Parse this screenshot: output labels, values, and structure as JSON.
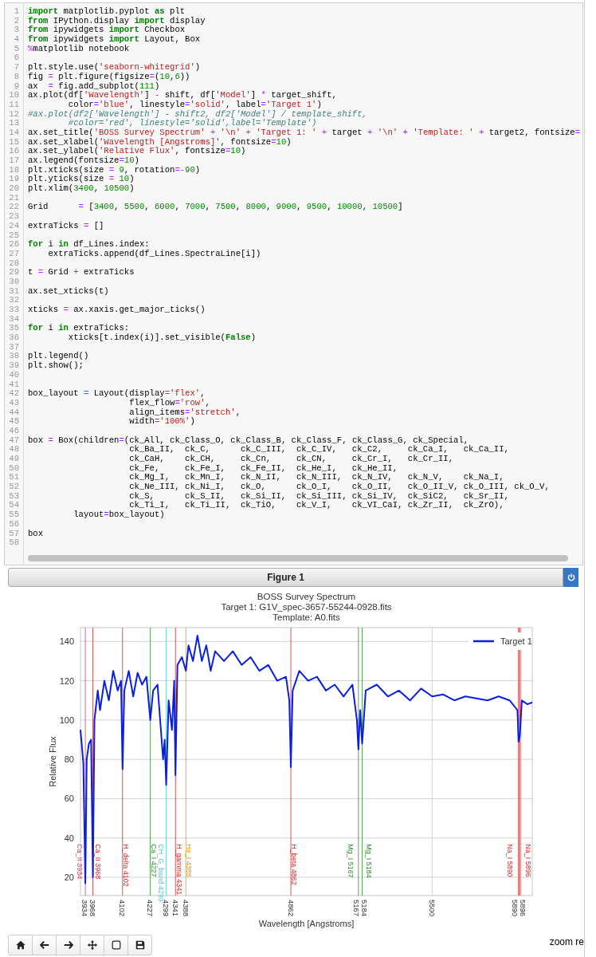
{
  "code_cell": {
    "lines": [
      {
        "number": "1",
        "tokens": [
          {
            "text": "import",
            "kind": "keyword"
          },
          {
            "text": " matplotlib.pyplot ",
            "kind": "plain"
          },
          {
            "text": "as",
            "kind": "keyword"
          },
          {
            "text": " plt",
            "kind": "plain"
          }
        ]
      },
      {
        "number": "2",
        "tokens": [
          {
            "text": "from",
            "kind": "keyword"
          },
          {
            "text": " IPython.display ",
            "kind": "plain"
          },
          {
            "text": "import",
            "kind": "keyword"
          },
          {
            "text": " display",
            "kind": "plain"
          }
        ]
      },
      {
        "number": "3",
        "tokens": [
          {
            "text": "from",
            "kind": "keyword"
          },
          {
            "text": " ipywidgets ",
            "kind": "plain"
          },
          {
            "text": "import",
            "kind": "keyword"
          },
          {
            "text": " Checkbox",
            "kind": "plain"
          }
        ]
      },
      {
        "number": "4",
        "tokens": [
          {
            "text": "from",
            "kind": "keyword"
          },
          {
            "text": " ipywidgets ",
            "kind": "plain"
          },
          {
            "text": "import",
            "kind": "keyword"
          },
          {
            "text": " Layout, Box",
            "kind": "plain"
          }
        ]
      },
      {
        "number": "5",
        "tokens": [
          {
            "text": "%",
            "kind": "operator"
          },
          {
            "text": "matplotlib notebook",
            "kind": "plain"
          }
        ]
      },
      {
        "number": "6"
      },
      {
        "number": "7",
        "tokens": [
          {
            "text": "plt.style.use(",
            "kind": "plain"
          },
          {
            "text": "'seaborn-whitegrid'",
            "kind": "string"
          },
          {
            "text": ")",
            "kind": "plain"
          }
        ]
      },
      {
        "number": "8",
        "tokens": [
          {
            "text": "fig ",
            "kind": "plain"
          },
          {
            "text": "=",
            "kind": "operator"
          },
          {
            "text": " plt.figure(figsize",
            "kind": "plain"
          },
          {
            "text": "=",
            "kind": "operator"
          },
          {
            "text": "(",
            "kind": "plain"
          },
          {
            "text": "10",
            "kind": "number"
          },
          {
            "text": ",",
            "kind": "plain"
          },
          {
            "text": "6",
            "kind": "number"
          },
          {
            "text": "))",
            "kind": "plain"
          }
        ]
      },
      {
        "number": "9",
        "tokens": [
          {
            "text": "ax  ",
            "kind": "plain"
          },
          {
            "text": "=",
            "kind": "operator"
          },
          {
            "text": " fig.add_subplot(",
            "kind": "plain"
          },
          {
            "text": "111",
            "kind": "number"
          },
          {
            "text": ")",
            "kind": "plain"
          }
        ]
      },
      {
        "number": "10",
        "tokens": [
          {
            "text": "ax.plot(df[",
            "kind": "plain"
          },
          {
            "text": "'Wavelength'",
            "kind": "string"
          },
          {
            "text": "] ",
            "kind": "plain"
          },
          {
            "text": "-",
            "kind": "operator"
          },
          {
            "text": " shift, df[",
            "kind": "plain"
          },
          {
            "text": "'Model'",
            "kind": "string"
          },
          {
            "text": "] ",
            "kind": "plain"
          },
          {
            "text": "*",
            "kind": "operator"
          },
          {
            "text": " target_shift,",
            "kind": "plain"
          }
        ]
      },
      {
        "number": "11",
        "tokens": [
          {
            "text": "        color",
            "kind": "plain"
          },
          {
            "text": "=",
            "kind": "operator"
          },
          {
            "text": "'blue'",
            "kind": "string"
          },
          {
            "text": ", linestyle",
            "kind": "plain"
          },
          {
            "text": "=",
            "kind": "operator"
          },
          {
            "text": "'solid'",
            "kind": "string"
          },
          {
            "text": ", label",
            "kind": "plain"
          },
          {
            "text": "=",
            "kind": "operator"
          },
          {
            "text": "'Target 1'",
            "kind": "string"
          },
          {
            "text": ")",
            "kind": "plain"
          }
        ]
      },
      {
        "number": "12",
        "tokens": [
          {
            "text": "#ax.plot(df2['Wavelength'] - shift2, df2['Model'] / template_shift,",
            "kind": "comment"
          }
        ]
      },
      {
        "number": "13",
        "tokens": [
          {
            "text": "        #color='red', linestyle='solid',label='Template')",
            "kind": "comment"
          }
        ]
      },
      {
        "number": "14",
        "tokens": [
          {
            "text": "ax.set_title(",
            "kind": "plain"
          },
          {
            "text": "'BOSS Survey Spectrum'",
            "kind": "string"
          },
          {
            "text": " + ",
            "kind": "operator"
          },
          {
            "text": "'\\n'",
            "kind": "string"
          },
          {
            "text": " + ",
            "kind": "operator"
          },
          {
            "text": "'Target 1: '",
            "kind": "string"
          },
          {
            "text": " + ",
            "kind": "operator"
          },
          {
            "text": "target",
            "kind": "plain"
          },
          {
            "text": " + ",
            "kind": "operator"
          },
          {
            "text": "'\\n'",
            "kind": "string"
          },
          {
            "text": " + ",
            "kind": "operator"
          },
          {
            "text": "'Template: '",
            "kind": "string"
          },
          {
            "text": " + ",
            "kind": "operator"
          },
          {
            "text": "target2, fontsize",
            "kind": "plain"
          },
          {
            "text": "=",
            "kind": "operator"
          }
        ]
      },
      {
        "number": "15",
        "tokens": [
          {
            "text": "ax.set_xlabel(",
            "kind": "plain"
          },
          {
            "text": "'Wavelength [Angstroms]'",
            "kind": "string"
          },
          {
            "text": ", fontsize",
            "kind": "plain"
          },
          {
            "text": "=",
            "kind": "operator"
          },
          {
            "text": "10",
            "kind": "number"
          },
          {
            "text": ")",
            "kind": "plain"
          }
        ]
      },
      {
        "number": "16",
        "tokens": [
          {
            "text": "ax.set_ylabel(",
            "kind": "plain"
          },
          {
            "text": "'Relative Flux'",
            "kind": "string"
          },
          {
            "text": ", fontsize",
            "kind": "plain"
          },
          {
            "text": "=",
            "kind": "operator"
          },
          {
            "text": "10",
            "kind": "number"
          },
          {
            "text": ")",
            "kind": "plain"
          }
        ]
      },
      {
        "number": "17",
        "tokens": [
          {
            "text": "ax.legend(fontsize",
            "kind": "plain"
          },
          {
            "text": "=",
            "kind": "operator"
          },
          {
            "text": "10",
            "kind": "number"
          },
          {
            "text": ")",
            "kind": "plain"
          }
        ]
      },
      {
        "number": "18",
        "tokens": [
          {
            "text": "plt.xticks(size ",
            "kind": "plain"
          },
          {
            "text": "= ",
            "kind": "operator"
          },
          {
            "text": "9",
            "kind": "number"
          },
          {
            "text": ", rotation",
            "kind": "plain"
          },
          {
            "text": "=-",
            "kind": "operator"
          },
          {
            "text": "90",
            "kind": "number"
          },
          {
            "text": ")",
            "kind": "plain"
          }
        ]
      },
      {
        "number": "19",
        "tokens": [
          {
            "text": "plt.yticks(size ",
            "kind": "plain"
          },
          {
            "text": "= ",
            "kind": "operator"
          },
          {
            "text": "10",
            "kind": "number"
          },
          {
            "text": ")",
            "kind": "plain"
          }
        ]
      },
      {
        "number": "20",
        "tokens": [
          {
            "text": "plt.xlim(",
            "kind": "plain"
          },
          {
            "text": "3400",
            "kind": "number"
          },
          {
            "text": ", ",
            "kind": "plain"
          },
          {
            "text": "10500",
            "kind": "number"
          },
          {
            "text": ")",
            "kind": "plain"
          }
        ]
      },
      {
        "number": "21"
      },
      {
        "number": "22",
        "tokens": [
          {
            "text": "Grid      ",
            "kind": "plain"
          },
          {
            "text": "=",
            "kind": "operator"
          },
          {
            "text": " [",
            "kind": "plain"
          },
          {
            "text": "3400",
            "kind": "number"
          },
          {
            "text": ", ",
            "kind": "plain"
          },
          {
            "text": "5500",
            "kind": "number"
          },
          {
            "text": ", ",
            "kind": "plain"
          },
          {
            "text": "6000",
            "kind": "number"
          },
          {
            "text": ", ",
            "kind": "plain"
          },
          {
            "text": "7000",
            "kind": "number"
          },
          {
            "text": ", ",
            "kind": "plain"
          },
          {
            "text": "7500",
            "kind": "number"
          },
          {
            "text": ", ",
            "kind": "plain"
          },
          {
            "text": "8000",
            "kind": "number"
          },
          {
            "text": ", ",
            "kind": "plain"
          },
          {
            "text": "9000",
            "kind": "number"
          },
          {
            "text": ", ",
            "kind": "plain"
          },
          {
            "text": "9500",
            "kind": "number"
          },
          {
            "text": ", ",
            "kind": "plain"
          },
          {
            "text": "10000",
            "kind": "number"
          },
          {
            "text": ", ",
            "kind": "plain"
          },
          {
            "text": "10500",
            "kind": "number"
          },
          {
            "text": "]",
            "kind": "plain"
          }
        ]
      },
      {
        "number": "23"
      },
      {
        "number": "24",
        "tokens": [
          {
            "text": "extraTicks ",
            "kind": "plain"
          },
          {
            "text": "=",
            "kind": "operator"
          },
          {
            "text": " []",
            "kind": "plain"
          }
        ]
      },
      {
        "number": "25"
      },
      {
        "number": "26",
        "tokens": [
          {
            "text": "for",
            "kind": "keyword"
          },
          {
            "text": " i ",
            "kind": "plain"
          },
          {
            "text": "in",
            "kind": "keyword"
          },
          {
            "text": " df_Lines.index:",
            "kind": "plain"
          }
        ]
      },
      {
        "number": "27",
        "tokens": [
          {
            "text": "    extraTicks.append(df_Lines.SpectraLine[i])",
            "kind": "plain"
          }
        ]
      },
      {
        "number": "28"
      },
      {
        "number": "29",
        "tokens": [
          {
            "text": "t ",
            "kind": "plain"
          },
          {
            "text": "=",
            "kind": "operator"
          },
          {
            "text": " Grid ",
            "kind": "plain"
          },
          {
            "text": "+",
            "kind": "operator"
          },
          {
            "text": " extraTicks",
            "kind": "plain"
          }
        ]
      },
      {
        "number": "30"
      },
      {
        "number": "31",
        "tokens": [
          {
            "text": "ax.set_xticks(t)",
            "kind": "plain"
          }
        ]
      },
      {
        "number": "32"
      },
      {
        "number": "33",
        "tokens": [
          {
            "text": "xticks ",
            "kind": "plain"
          },
          {
            "text": "=",
            "kind": "operator"
          },
          {
            "text": " ax.xaxis.get_major_ticks()",
            "kind": "plain"
          }
        ]
      },
      {
        "number": "34"
      },
      {
        "number": "35",
        "tokens": [
          {
            "text": "for",
            "kind": "keyword"
          },
          {
            "text": " i ",
            "kind": "plain"
          },
          {
            "text": "in",
            "kind": "keyword"
          },
          {
            "text": " extraTicks:",
            "kind": "plain"
          }
        ]
      },
      {
        "number": "36",
        "tokens": [
          {
            "text": "        xticks[t.index(i)].set_visible(",
            "kind": "plain"
          },
          {
            "text": "False",
            "kind": "keyword"
          },
          {
            "text": ")",
            "kind": "plain"
          }
        ]
      },
      {
        "number": "37"
      },
      {
        "number": "38",
        "tokens": [
          {
            "text": "plt.legend()",
            "kind": "plain"
          }
        ]
      },
      {
        "number": "39",
        "tokens": [
          {
            "text": "plt.show();",
            "kind": "plain"
          }
        ]
      },
      {
        "number": "40"
      },
      {
        "number": "41"
      },
      {
        "number": "42",
        "tokens": [
          {
            "text": "box_layout ",
            "kind": "plain"
          },
          {
            "text": "=",
            "kind": "operator"
          },
          {
            "text": " Layout(display",
            "kind": "plain"
          },
          {
            "text": "=",
            "kind": "operator"
          },
          {
            "text": "'flex'",
            "kind": "string"
          },
          {
            "text": ",",
            "kind": "plain"
          }
        ]
      },
      {
        "number": "43",
        "tokens": [
          {
            "text": "                    flex_flow",
            "kind": "plain"
          },
          {
            "text": "=",
            "kind": "operator"
          },
          {
            "text": "'row'",
            "kind": "string"
          },
          {
            "text": ",",
            "kind": "plain"
          }
        ]
      },
      {
        "number": "44",
        "tokens": [
          {
            "text": "                    align_items",
            "kind": "plain"
          },
          {
            "text": "=",
            "kind": "operator"
          },
          {
            "text": "'stretch'",
            "kind": "string"
          },
          {
            "text": ",",
            "kind": "plain"
          }
        ]
      },
      {
        "number": "45",
        "tokens": [
          {
            "text": "                    width",
            "kind": "plain"
          },
          {
            "text": "=",
            "kind": "operator"
          },
          {
            "text": "'100%'",
            "kind": "string"
          },
          {
            "text": ")",
            "kind": "plain"
          }
        ]
      },
      {
        "number": "46"
      },
      {
        "number": "47",
        "tokens": [
          {
            "text": "box ",
            "kind": "plain"
          },
          {
            "text": "=",
            "kind": "operator"
          },
          {
            "text": " Box(children",
            "kind": "plain"
          },
          {
            "text": "=",
            "kind": "operator"
          },
          {
            "text": "(ck_All, ck_Class_O, ck_Class_B, ck_Class_F, ck_Class_G, ck_Special,",
            "kind": "plain"
          }
        ]
      },
      {
        "number": "48",
        "tokens": [
          {
            "text": "                    ck_Ba_II,  ck_C,      ck_C_III,  ck_C_IV,   ck_C2,     ck_Ca_I,   ck_Ca_II,",
            "kind": "plain"
          }
        ]
      },
      {
        "number": "49",
        "tokens": [
          {
            "text": "                    ck_CaH,    ck_CH,     ck_Cn,     ck_CN,     ck_Cr_I,   ck_Cr_II,",
            "kind": "plain"
          }
        ]
      },
      {
        "number": "50",
        "tokens": [
          {
            "text": "                    ck_Fe,     ck_Fe_I,   ck_Fe_II,  ck_He_I,   ck_He_II,",
            "kind": "plain"
          }
        ]
      },
      {
        "number": "51",
        "tokens": [
          {
            "text": "                    ck_Mg_I,   ck_Mn_I,   ck_N_II,   ck_N_III,  ck_N_IV,   ck_N_V,    ck_Na_I,",
            "kind": "plain"
          }
        ]
      },
      {
        "number": "52",
        "tokens": [
          {
            "text": "                    ck_Ne_III, ck_Ni_I,   ck_O,      ck_O_I,    ck_O_II,   ck_O_II_V, ck_O_III, ck_O_V,",
            "kind": "plain"
          }
        ]
      },
      {
        "number": "53",
        "tokens": [
          {
            "text": "                    ck_S,      ck_S_II,   ck_Si_II,  ck_Si_III, ck_Si_IV,  ck_SiC2,   ck_Sr_II,",
            "kind": "plain"
          }
        ]
      },
      {
        "number": "54",
        "tokens": [
          {
            "text": "                    ck_Ti_I,   ck_Ti_II,  ck_TiO,    ck_V_I,    ck_VI_CaI, ck_Zr_II,  ck_ZrO),",
            "kind": "plain"
          }
        ]
      },
      {
        "number": "55",
        "tokens": [
          {
            "text": "         layout",
            "kind": "plain"
          },
          {
            "text": "=",
            "kind": "operator"
          },
          {
            "text": "box_layout)",
            "kind": "plain"
          }
        ]
      },
      {
        "number": "56"
      },
      {
        "number": "57",
        "tokens": [
          {
            "text": "box",
            "kind": "plain"
          }
        ]
      },
      {
        "number": "58"
      }
    ]
  },
  "figure": {
    "title": "Figure 1",
    "chart_data": {
      "type": "line",
      "title": "BOSS Survey Spectrum\nTarget 1: G1V_spec-3657-55244-0928.fits\nTemplate: A0.fits",
      "xlabel": "Wavelength [Angstroms]",
      "ylabel": "Relative Flux",
      "x": [
        3912,
        3925,
        3934,
        3940,
        3950,
        3960,
        3968,
        3975,
        3990,
        4000,
        4020,
        4040,
        4060,
        4080,
        4095,
        4102,
        4110,
        4130,
        4150,
        4170,
        4190,
        4210,
        4227,
        4240,
        4260,
        4275,
        4285,
        4292,
        4299,
        4310,
        4325,
        4335,
        4341,
        4350,
        4370,
        4388,
        4400,
        4420,
        4440,
        4460,
        4480,
        4500,
        4520,
        4560,
        4600,
        4640,
        4680,
        4720,
        4760,
        4800,
        4840,
        4855,
        4862,
        4870,
        4900,
        4940,
        4980,
        5020,
        5060,
        5100,
        5140,
        5160,
        5167,
        5175,
        5184,
        5200,
        5250,
        5300,
        5350,
        5400,
        5450,
        5500,
        5550,
        5600,
        5650,
        5700,
        5750,
        5800,
        5850,
        5885,
        5890,
        5896,
        5905,
        5930,
        5952
      ],
      "series": [
        {
          "name": "Target 1",
          "color": "#0a1fe0",
          "values": [
            95,
            78,
            17,
            80,
            88,
            90,
            20,
            100,
            115,
            105,
            120,
            110,
            125,
            115,
            120,
            75,
            115,
            125,
            112,
            124,
            118,
            122,
            100,
            115,
            118,
            95,
            80,
            90,
            67,
            110,
            95,
            120,
            72,
            128,
            132,
            125,
            138,
            130,
            143,
            130,
            138,
            125,
            135,
            130,
            135,
            128,
            132,
            125,
            128,
            120,
            122,
            110,
            76,
            115,
            125,
            120,
            122,
            115,
            118,
            112,
            118,
            100,
            85,
            105,
            88,
            115,
            118,
            112,
            115,
            110,
            116,
            112,
            113,
            110,
            112,
            111,
            110,
            112,
            110,
            105,
            89,
            92,
            110,
            108,
            109
          ]
        }
      ],
      "xlim": [
        3912,
        5952
      ],
      "ylim": [
        10.7,
        147
      ],
      "xticks": [
        3934,
        3968,
        4102,
        4227,
        4299,
        4341,
        4388,
        4862,
        5167,
        5184,
        5500,
        5890,
        5896
      ],
      "yticks": [
        20,
        40,
        60,
        80,
        100,
        120,
        140
      ],
      "grid": true,
      "ref_lines": [
        {
          "axis": "x",
          "value": 3934,
          "label": "Ca_II 3934",
          "color": "#e0405a"
        },
        {
          "axis": "x",
          "value": 3968,
          "label": "Ca_II 3968",
          "color": "#d62728"
        },
        {
          "axis": "x",
          "value": 4102,
          "label": "H_delta 4102",
          "color": "#d62728"
        },
        {
          "axis": "x",
          "value": 4227,
          "label": "Ca_I 4227",
          "color": "#2e8b2e"
        },
        {
          "axis": "x",
          "value": 4299,
          "label": "CH_G_band 4299",
          "color": "#4cc8d4"
        },
        {
          "axis": "x",
          "value": 4341,
          "label": "H_gamma 4341",
          "color": "#d62728"
        },
        {
          "axis": "x",
          "value": 4388,
          "label": "He_I 4388",
          "color": "#e89a10"
        },
        {
          "axis": "x",
          "value": 4862,
          "label": "H_beta 4862",
          "color": "#d62728"
        },
        {
          "axis": "x",
          "value": 5167,
          "label": "Mg_I 5167",
          "color": "#2e8b2e"
        },
        {
          "axis": "x",
          "value": 5184,
          "label": "Mg_I 5184",
          "color": "#2e8b2e"
        },
        {
          "axis": "x",
          "value": 5890,
          "label": "Na_I 5890",
          "color": "#d62728"
        },
        {
          "axis": "x",
          "value": 5896,
          "label": "Na_I 5896",
          "color": "#d62728"
        }
      ],
      "bands": [
        {
          "axis": "x",
          "from": 5886,
          "to": 5906
        }
      ]
    },
    "toolbar": [
      {
        "kind": "home"
      },
      {
        "kind": "back"
      },
      {
        "kind": "forward"
      },
      {
        "kind": "pan"
      },
      {
        "kind": "zoom"
      },
      {
        "kind": "save"
      }
    ],
    "status": "zoom re"
  }
}
